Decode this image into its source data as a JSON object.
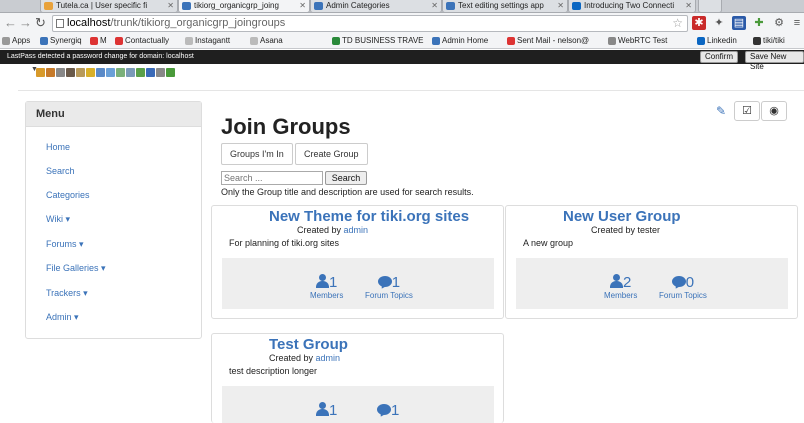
{
  "browser": {
    "tabs": [
      {
        "label": "Tutela.ca | User specific fi",
        "active": false
      },
      {
        "label": "tikiorg_organicgrp_joing",
        "active": true
      },
      {
        "label": "Admin Categories",
        "active": false
      },
      {
        "label": "Text editing settings app",
        "active": false
      },
      {
        "label": "Introducing Two Connecti",
        "active": false
      }
    ],
    "url_host": "localhost",
    "url_path": "/trunk/tikiorg_organicgrp_joingroups",
    "bookmarks": [
      "Apps",
      "Synergiq",
      "M",
      "Contactually",
      "Instagantt",
      "Asana",
      "TD BUSINESS TRAVE",
      "Admin Home",
      "Sent Mail - nelson@",
      "WebRTC Test",
      "Linkedin",
      "tiki/tiki"
    ],
    "notification_text": "LastPass detected a password change for domain: localhost",
    "notification_confirm": "Confirm",
    "notification_save": "Save New Site"
  },
  "menu": {
    "title": "Menu",
    "items": [
      {
        "label": "Home"
      },
      {
        "label": "Search"
      },
      {
        "label": "Categories"
      },
      {
        "label": "Wiki ▾"
      },
      {
        "label": "Forums ▾"
      },
      {
        "label": "File Galleries ▾"
      },
      {
        "label": "Trackers ▾"
      },
      {
        "label": "Admin ▾"
      }
    ]
  },
  "main": {
    "title": "Join Groups",
    "tab_groups": "Groups I'm In",
    "tab_create": "Create Group",
    "search_placeholder": "Search ...",
    "search_button": "Search",
    "search_note": "Only the Group title and description are used for search results."
  },
  "groups": [
    {
      "title": "New Theme for tiki.org sites",
      "created_prefix": "Created by ",
      "creator": "admin",
      "creator_link": true,
      "description": "For planning of tiki.org sites",
      "members": "1",
      "topics": "1",
      "members_label": "Members",
      "topics_label": "Forum Topics"
    },
    {
      "title": "New User Group",
      "created_prefix": "Created by ",
      "creator": "tester",
      "creator_link": false,
      "description": "A new group",
      "members": "2",
      "topics": "0",
      "members_label": "Members",
      "topics_label": "Forum Topics"
    },
    {
      "title": "Test Group",
      "created_prefix": "Created by ",
      "creator": "admin",
      "creator_link": true,
      "description": "test description longer",
      "members": "1",
      "topics": "1",
      "members_label": "",
      "topics_label": ""
    }
  ],
  "colors": {
    "link": "#3b73b9",
    "footer": "#eeeeee"
  }
}
